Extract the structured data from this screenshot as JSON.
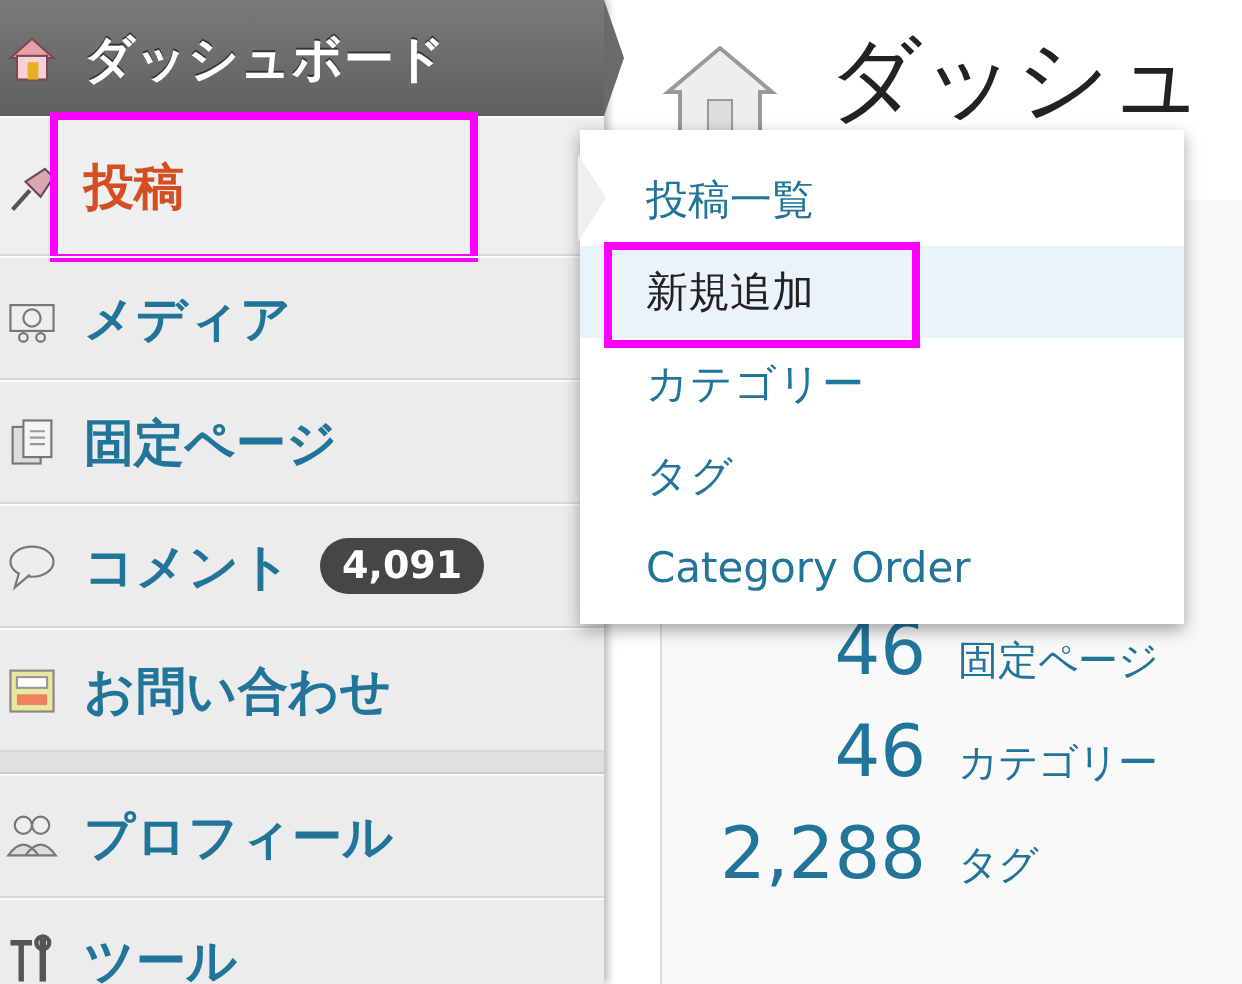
{
  "sidebar": {
    "items": [
      {
        "label": "ダッシュボード",
        "current": true,
        "hover": false,
        "highlighted": false
      },
      {
        "label": "投稿",
        "current": false,
        "hover": true,
        "highlighted": true
      },
      {
        "label": "メディア",
        "current": false,
        "hover": false,
        "highlighted": false
      },
      {
        "label": "固定ページ",
        "current": false,
        "hover": false,
        "highlighted": false
      },
      {
        "label": "コメント",
        "current": false,
        "hover": false,
        "highlighted": false,
        "badge": "4,091"
      },
      {
        "label": "お問い合わせ",
        "current": false,
        "hover": false,
        "highlighted": false,
        "separator_after": true
      },
      {
        "label": "プロフィール",
        "current": false,
        "hover": false,
        "highlighted": false
      },
      {
        "label": "ツール",
        "current": false,
        "hover": false,
        "highlighted": false
      }
    ]
  },
  "page": {
    "title": "ダッシュ",
    "stats": [
      {
        "count": "46",
        "label": "固定ページ"
      },
      {
        "count": "46",
        "label": "カテゴリー"
      },
      {
        "count": "2,288",
        "label": "タグ"
      }
    ]
  },
  "submenu": {
    "items": [
      {
        "label": "投稿一覧",
        "selected": false,
        "highlighted": false
      },
      {
        "label": "新規追加",
        "selected": true,
        "highlighted": true
      },
      {
        "label": "カテゴリー",
        "selected": false,
        "highlighted": false
      },
      {
        "label": "タグ",
        "selected": false,
        "highlighted": false
      },
      {
        "label": "Category Order",
        "selected": false,
        "highlighted": false
      }
    ]
  }
}
